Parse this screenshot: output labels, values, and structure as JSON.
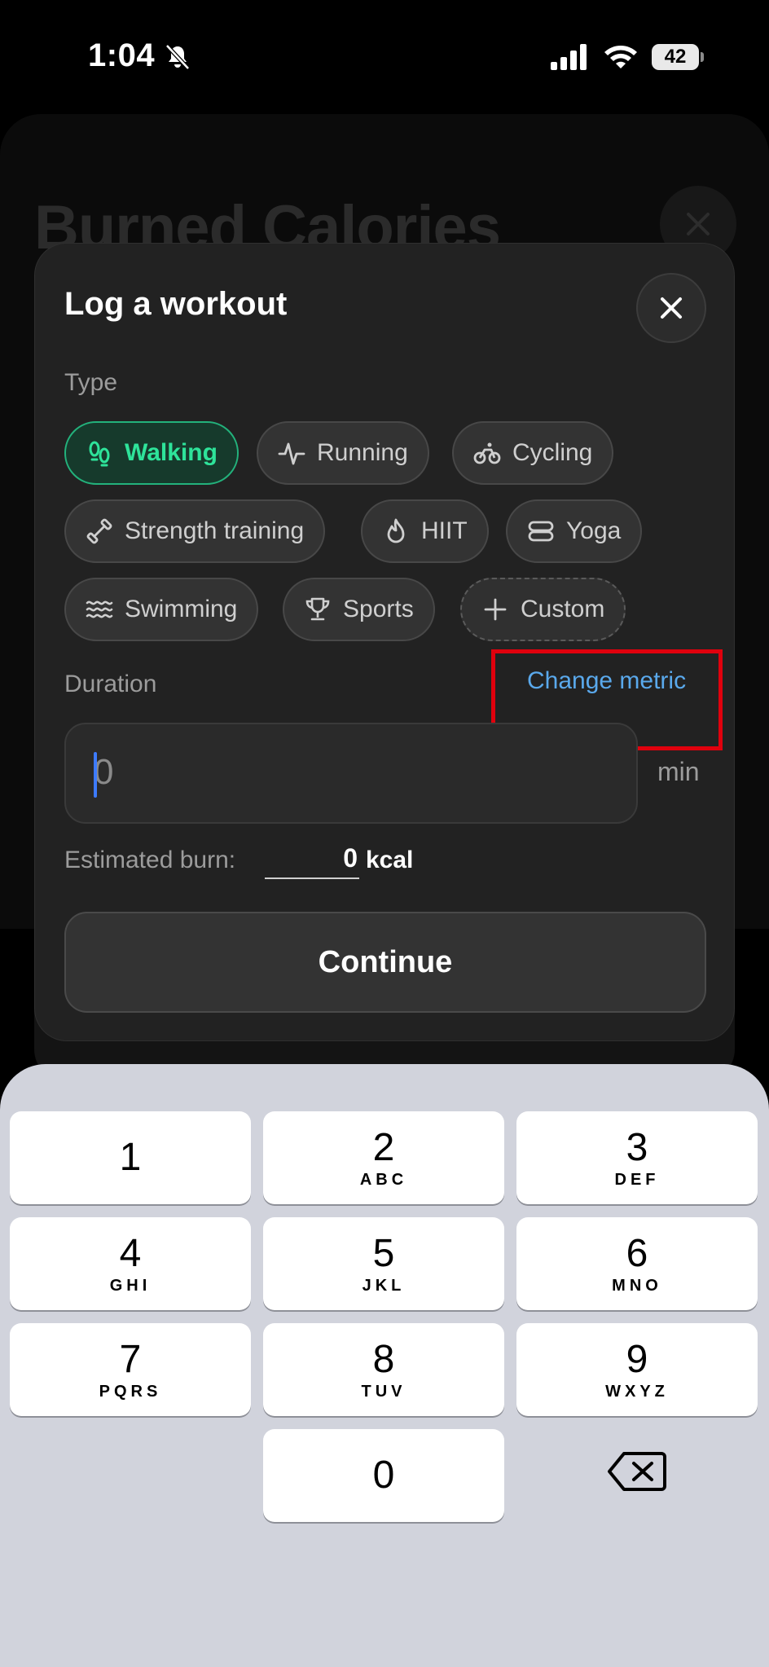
{
  "status_bar": {
    "time": "1:04",
    "battery": "42"
  },
  "background": {
    "title": "Burned Calories"
  },
  "modal": {
    "title": "Log a workout",
    "type_label": "Type",
    "workout_types": [
      {
        "label": "Walking",
        "icon": "footprints-icon",
        "selected": true
      },
      {
        "label": "Running",
        "icon": "pulse-icon"
      },
      {
        "label": "Cycling",
        "icon": "bicycle-icon"
      },
      {
        "label": "Strength training",
        "icon": "dumbbell-icon"
      },
      {
        "label": "HIIT",
        "icon": "flame-icon"
      },
      {
        "label": "Yoga",
        "icon": "mat-icon"
      },
      {
        "label": "Swimming",
        "icon": "waves-icon"
      },
      {
        "label": "Sports",
        "icon": "trophy-icon"
      },
      {
        "label": "Custom",
        "icon": "plus-icon"
      }
    ],
    "duration_label": "Duration",
    "change_metric": "Change metric",
    "duration_value": "0",
    "duration_unit": "min",
    "estimated_burn_label": "Estimated burn:",
    "estimated_burn_value": "0",
    "estimated_burn_unit": "kcal",
    "continue_label": "Continue"
  },
  "keypad": {
    "keys": [
      {
        "digit": "1",
        "letters": ""
      },
      {
        "digit": "2",
        "letters": "ABC"
      },
      {
        "digit": "3",
        "letters": "DEF"
      },
      {
        "digit": "4",
        "letters": "GHI"
      },
      {
        "digit": "5",
        "letters": "JKL"
      },
      {
        "digit": "6",
        "letters": "MNO"
      },
      {
        "digit": "7",
        "letters": "PQRS"
      },
      {
        "digit": "8",
        "letters": "TUV"
      },
      {
        "digit": "9",
        "letters": "WXYZ"
      },
      {
        "digit": "0",
        "letters": ""
      }
    ],
    "delete_icon": "backspace-icon"
  },
  "colors": {
    "accent_green": "#2ee39a",
    "link_blue": "#5aa9ec",
    "highlight_red": "#e0000d",
    "keypad_bg": "#d1d3dc"
  }
}
